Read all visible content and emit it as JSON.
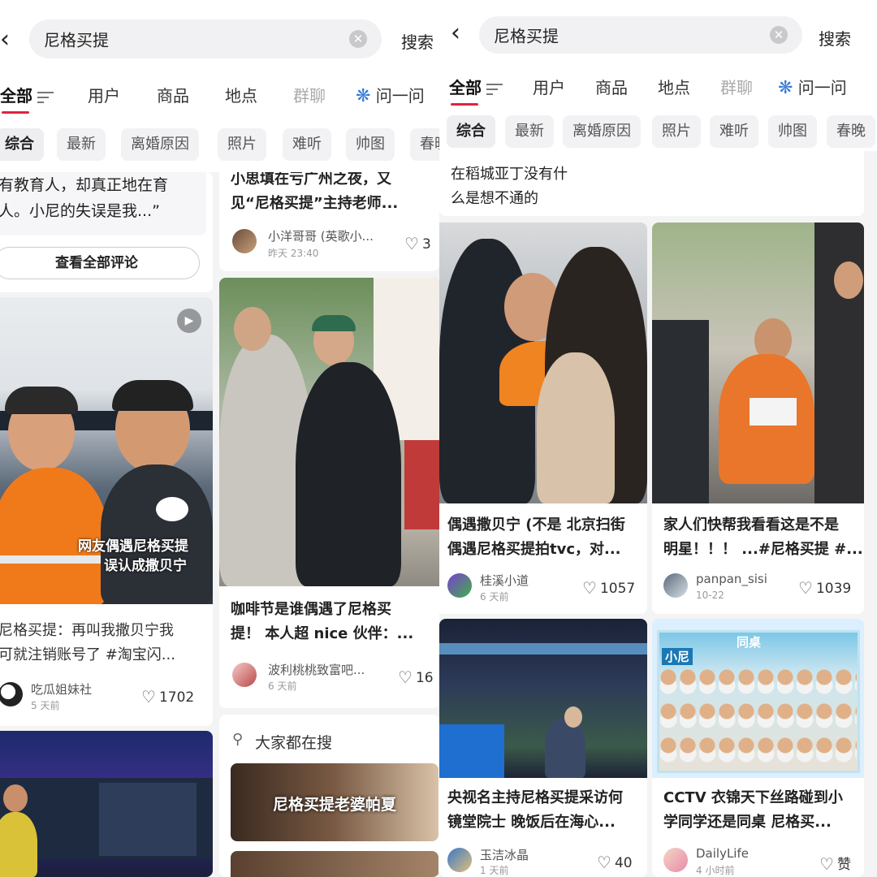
{
  "left": {
    "search": {
      "query": "尼格买提",
      "button": "搜索"
    },
    "tabs": [
      "全部",
      "用户",
      "商品",
      "地点",
      "群聊",
      "问一问"
    ],
    "chips": [
      "综合",
      "最新",
      "离婚原因",
      "照片",
      "难听",
      "帅图",
      "春晚"
    ],
    "comment": {
      "line1": "有教育人，却真正地在育",
      "line2": "人。小尼的失误是我...”",
      "view_all": "查看全部评论"
    },
    "top_right": {
      "line1": "小思填在亏广州之夜，又",
      "line2": "见“尼格买提”主持老师...",
      "user": "小洋哥哥 (英歌小...",
      "time": "昨天 23:40",
      "likes": "3"
    },
    "card_a": {
      "overlay_line1": "网友偶遇尼格买提",
      "overlay_line2": "误认成撒贝宁",
      "logo": "吃瓜姐妹社",
      "title1": "尼格买提：再叫我撒贝宁我",
      "title2": "可就注销账号了 #淘宝闪...",
      "user": "吃瓜姐妹社",
      "time": "5 天前",
      "likes": "1702"
    },
    "card_b": {
      "title1": "咖啡节是谁偶遇了尼格买",
      "title2": "提！ 本人超 nice 伙伴：...",
      "user": "波利桃桃致富吧...",
      "time": "6 天前",
      "likes": "16"
    },
    "everyone_search": {
      "label": "大家都在搜",
      "item1": "尼格买提老婆帕夏"
    }
  },
  "right": {
    "search": {
      "query": "尼格买提",
      "button": "搜索"
    },
    "tabs": [
      "全部",
      "用户",
      "商品",
      "地点",
      "群聊",
      "问一问"
    ],
    "chips": [
      "综合",
      "最新",
      "离婚原因",
      "照片",
      "难听",
      "帅图",
      "春晚"
    ],
    "top_text": {
      "line1": "在稻城亚丁没有什",
      "line2": "么是想不通的"
    },
    "card_a": {
      "title1": "偶遇撒贝宁 (不是 北京扫街",
      "title2": "偶遇尼格买提拍tvc，对...",
      "user": "桂溪小道",
      "time": "6 天前",
      "likes": "1057"
    },
    "card_b": {
      "title1": "家人们快帮我看看这是不是",
      "title2": "明星！！！ ...#尼格买提 #...",
      "user": "panpan_sisi",
      "time": "10-22",
      "likes": "1039"
    },
    "card_c": {
      "title1": "央视名主持尼格买提采访何",
      "title2": "镜堂院士 晚饭后在海心...",
      "user": "玉洁冰晶",
      "time": "1 天前",
      "likes": "40"
    },
    "card_d": {
      "overlay1": "小尼",
      "overlay2": "同桌",
      "title1": "CCTV 衣锦天下丝路碰到小",
      "title2": "学同学还是同桌 尼格买...",
      "user": "DailyLife",
      "time": "4 小时前",
      "likes": "赞"
    }
  }
}
